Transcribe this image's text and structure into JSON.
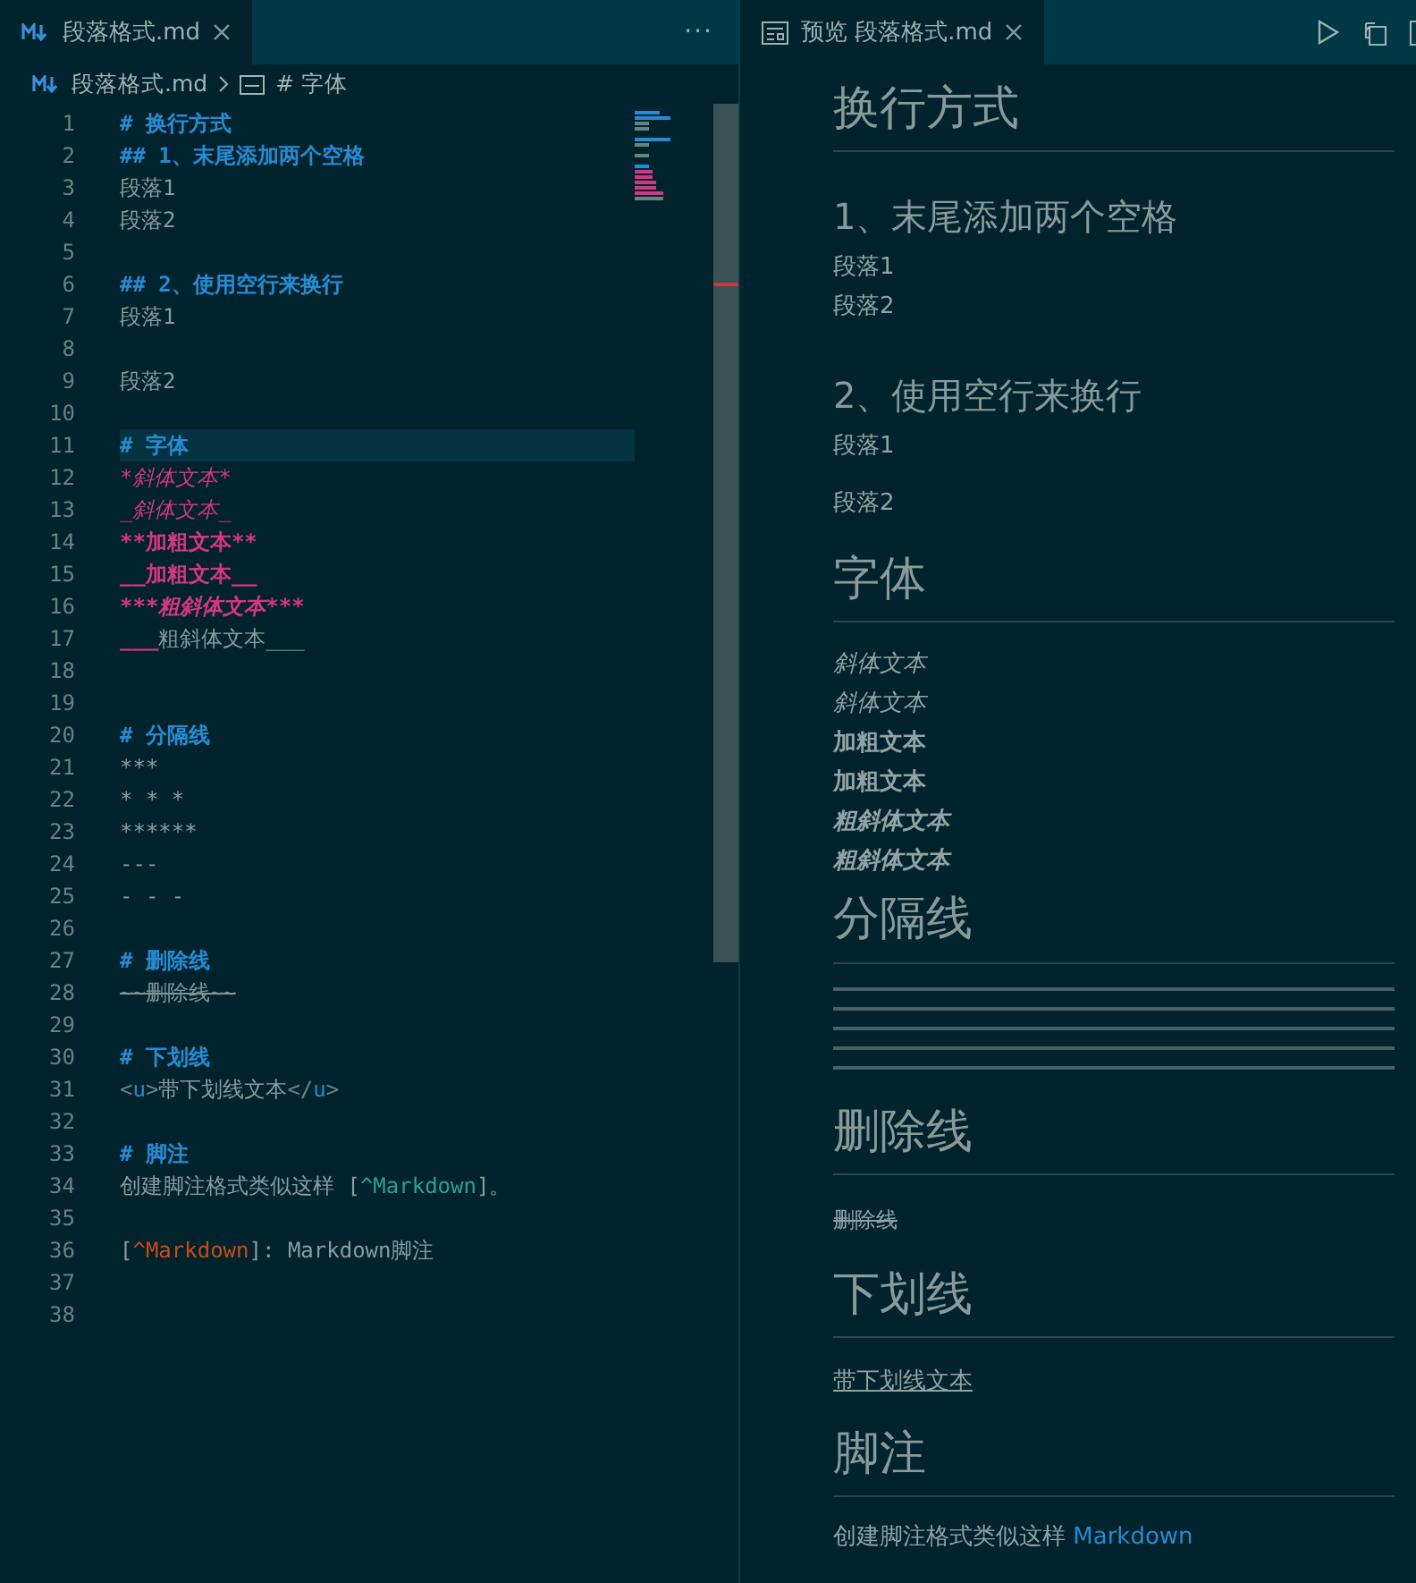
{
  "editor": {
    "tabs": [
      {
        "label": "段落格式.md",
        "selected": true
      }
    ],
    "more": "···",
    "breadcrumb": [
      "段落格式.md",
      "# 字体"
    ],
    "lines": [
      {
        "number": "1",
        "current": false,
        "segments": [
          {
            "kind": "heading",
            "text": "# 换行方式"
          }
        ]
      },
      {
        "number": "2",
        "current": false,
        "segments": [
          {
            "kind": "heading",
            "text": "## 1、末尾添加两个空格"
          }
        ]
      },
      {
        "number": "3",
        "current": false,
        "segments": [
          {
            "kind": "plain",
            "text": "段落1"
          }
        ]
      },
      {
        "number": "4",
        "current": false,
        "segments": [
          {
            "kind": "plain",
            "text": "段落2"
          }
        ]
      },
      {
        "number": "5",
        "current": false
      },
      {
        "number": "6",
        "current": false,
        "segments": [
          {
            "kind": "heading",
            "text": "## 2、使用空行来换行"
          }
        ]
      },
      {
        "number": "7",
        "current": false,
        "segments": [
          {
            "kind": "plain",
            "text": "段落1"
          }
        ]
      },
      {
        "number": "8",
        "current": false
      },
      {
        "number": "9",
        "current": false,
        "segments": [
          {
            "kind": "plain",
            "text": "段落2"
          }
        ]
      },
      {
        "number": "10",
        "current": false
      },
      {
        "number": "11",
        "current": true,
        "segments": [
          {
            "kind": "heading",
            "text": "# 字体"
          }
        ]
      },
      {
        "number": "12",
        "current": false,
        "segments": [
          {
            "kind": "emphasis",
            "text": "*斜体文本*"
          }
        ]
      },
      {
        "number": "13",
        "current": false,
        "segments": [
          {
            "kind": "emphasis",
            "text": "_斜体文本_"
          }
        ]
      },
      {
        "number": "14",
        "current": false,
        "segments": [
          {
            "kind": "strong",
            "text": "**加粗文本**"
          }
        ]
      },
      {
        "number": "15",
        "current": false,
        "segments": [
          {
            "kind": "strong",
            "text": "__加粗文本__"
          }
        ]
      },
      {
        "number": "16",
        "current": false,
        "segments": [
          {
            "kind": "strongemphasis",
            "text": "***粗斜体文本***"
          }
        ]
      },
      {
        "number": "17",
        "current": false,
        "segments": [
          {
            "kind": "strong",
            "text": "___"
          },
          {
            "kind": "plain",
            "text": "粗斜体文本___"
          }
        ]
      },
      {
        "number": "18",
        "current": false
      },
      {
        "number": "19",
        "current": false
      },
      {
        "number": "20",
        "current": false,
        "segments": [
          {
            "kind": "heading",
            "text": "# 分隔线"
          }
        ]
      },
      {
        "number": "21",
        "current": false,
        "segments": [
          {
            "kind": "plain",
            "text": "***"
          }
        ]
      },
      {
        "number": "22",
        "current": false,
        "segments": [
          {
            "kind": "plain",
            "text": "* * *"
          }
        ]
      },
      {
        "number": "23",
        "current": false,
        "segments": [
          {
            "kind": "plain",
            "text": "******"
          }
        ]
      },
      {
        "number": "24",
        "current": false,
        "segments": [
          {
            "kind": "plain",
            "text": "---"
          }
        ]
      },
      {
        "number": "25",
        "current": false,
        "segments": [
          {
            "kind": "plain",
            "text": "- - -"
          }
        ]
      },
      {
        "number": "26",
        "current": false
      },
      {
        "number": "27",
        "current": false,
        "segments": [
          {
            "kind": "heading",
            "text": "# 删除线"
          }
        ]
      },
      {
        "number": "28",
        "current": false,
        "segments": [
          {
            "kind": "strike",
            "text": "~~删除线~~"
          }
        ]
      },
      {
        "number": "29",
        "current": false
      },
      {
        "number": "30",
        "current": false,
        "segments": [
          {
            "kind": "heading",
            "text": "# 下划线"
          }
        ]
      },
      {
        "number": "31",
        "current": false,
        "segments": [
          {
            "kind": "punct",
            "text": "<"
          },
          {
            "kind": "tag",
            "text": "u"
          },
          {
            "kind": "punct",
            "text": ">"
          },
          {
            "kind": "plain",
            "text": "带下划线文本"
          },
          {
            "kind": "punct",
            "text": "</"
          },
          {
            "kind": "tag",
            "text": "u"
          },
          {
            "kind": "punct",
            "text": ">"
          }
        ]
      },
      {
        "number": "32",
        "current": false
      },
      {
        "number": "33",
        "current": false,
        "segments": [
          {
            "kind": "heading",
            "text": "# 脚注"
          }
        ]
      },
      {
        "number": "34",
        "current": false,
        "segments": [
          {
            "kind": "plain",
            "text": "创建脚注格式类似这样 ["
          },
          {
            "kind": "link",
            "text": "^Markdown"
          },
          {
            "kind": "plain",
            "text": "]。"
          }
        ]
      },
      {
        "number": "35",
        "current": false
      },
      {
        "number": "36",
        "current": false,
        "segments": [
          {
            "kind": "plain",
            "text": "["
          },
          {
            "kind": "ref",
            "text": "^Markdown"
          },
          {
            "kind": "plain",
            "text": "]: Markdown脚注"
          }
        ]
      },
      {
        "number": "37",
        "current": false
      },
      {
        "number": "38",
        "current": false
      }
    ]
  },
  "preview": {
    "tabs": [
      {
        "label": "预览 段落格式.md",
        "selected": true
      }
    ],
    "blocks": [
      {
        "kind": "h1",
        "text": "换行方式"
      },
      {
        "kind": "h2",
        "text": "1、末尾添加两个空格"
      },
      {
        "kind": "line",
        "text": "段落1"
      },
      {
        "kind": "line",
        "text": "段落2"
      },
      {
        "kind": "h2",
        "text": "2、使用空行来换行"
      },
      {
        "kind": "p",
        "text": "段落1"
      },
      {
        "kind": "p",
        "text": "段落2"
      },
      {
        "kind": "h1",
        "text": "字体"
      },
      {
        "kind": "italic",
        "text": "斜体文本"
      },
      {
        "kind": "italic",
        "text": "斜体文本"
      },
      {
        "kind": "bold",
        "text": "加粗文本"
      },
      {
        "kind": "bold",
        "text": "加粗文本"
      },
      {
        "kind": "bolditalic",
        "text": "粗斜体文本"
      },
      {
        "kind": "bolditalic",
        "text": "粗斜体文本"
      },
      {
        "kind": "h1",
        "text": "分隔线"
      },
      {
        "kind": "hr"
      },
      {
        "kind": "hr"
      },
      {
        "kind": "hr"
      },
      {
        "kind": "hr"
      },
      {
        "kind": "hr"
      },
      {
        "kind": "h1",
        "text": "删除线"
      },
      {
        "kind": "strike",
        "text": "删除线"
      },
      {
        "kind": "h1",
        "text": "下划线"
      },
      {
        "kind": "underline",
        "text": "带下划线文本"
      },
      {
        "kind": "h1",
        "text": "脚注"
      },
      {
        "kind": "footnote",
        "text": "创建脚注格式类似这样",
        "link": "Markdown"
      }
    ]
  }
}
